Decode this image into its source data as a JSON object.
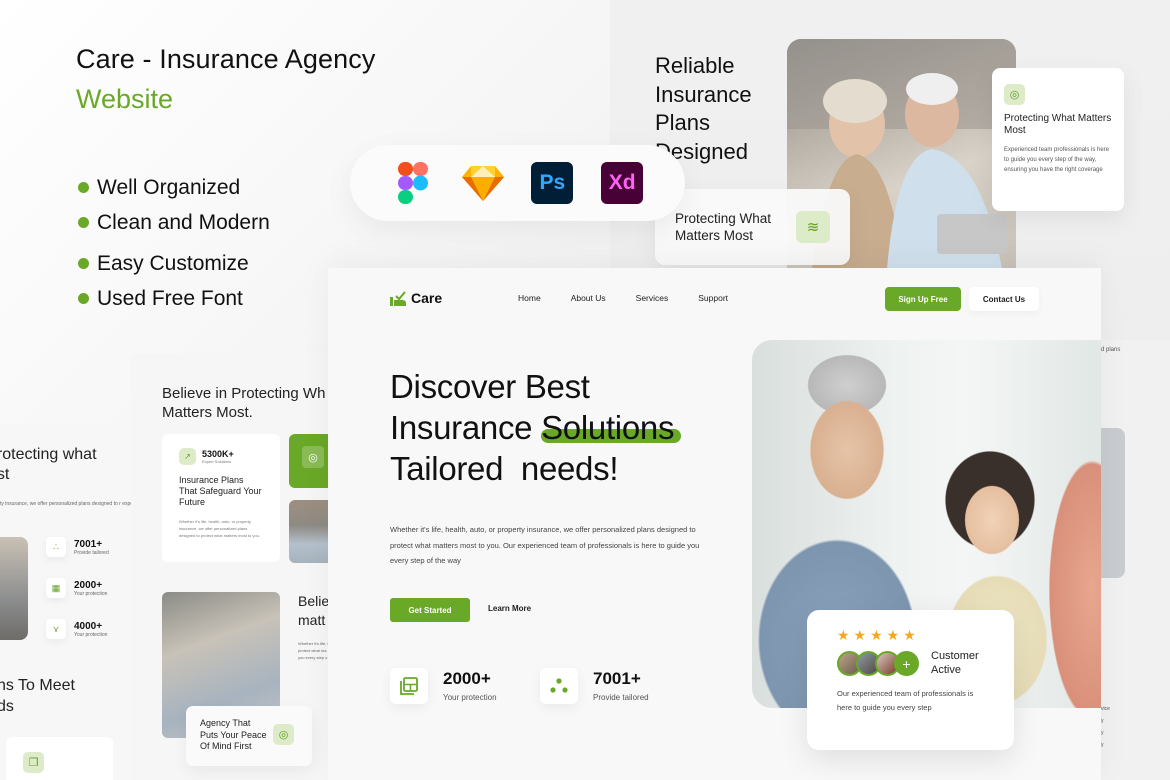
{
  "promo": {
    "title": "Care - Insurance Agency",
    "subtitle": "Website",
    "accent_color": "#6aa827",
    "features": [
      "Well Organized",
      "Clean and Modern",
      "Easy Customize",
      "Used Free Font"
    ],
    "tools": [
      {
        "name": "Figma",
        "icon": "figma-icon"
      },
      {
        "name": "Sketch",
        "icon": "sketch-icon"
      },
      {
        "name": "Photoshop",
        "icon": "photoshop-icon",
        "label": "Ps"
      },
      {
        "name": "Adobe XD",
        "icon": "xd-icon",
        "label": "Xd"
      }
    ]
  },
  "top_right_preview": {
    "heading": [
      "Reliable",
      "Insurance",
      "Plans",
      "Designed"
    ],
    "side_card": {
      "title": "Protecting What Matters Most",
      "text": "Experienced team professionals is here to guide you every step of the way, ensuring you have the right coverage"
    },
    "pill": {
      "title": "Protecting What Matters Most"
    }
  },
  "left_preview_1": {
    "heading": "protecting what most",
    "text": "ty insurance, we offer personalized plans designed to r experienced team of professionals is here to guide",
    "stats": [
      {
        "value": "7001+",
        "caption": "Provide tailored"
      },
      {
        "value": "2000+",
        "caption": "Your protection"
      },
      {
        "value": "4000+",
        "caption": "Your protection"
      }
    ],
    "heading2": "ns To Meet ds"
  },
  "left_preview_2": {
    "heading": "Believe in Protecting Wh Matters Most.",
    "card": {
      "stat_value": "5300K+",
      "stat_caption": "Expert Solutions",
      "title": "Insurance Plans That Safeguard Your Future",
      "text": "Whether it's life, health, auto, or property insurance, we offer personalized plans designed to protect what matters most to you."
    },
    "heading3": "Belie matt",
    "text3": "Whether it's life, i protect what ma you every step o",
    "pill_title": "Agency That Puts Your Peace Of Mind First"
  },
  "right_strip": {
    "text": "d plans",
    "footer": [
      "vice",
      "y",
      "y",
      "y"
    ]
  },
  "main": {
    "brand": "Care",
    "nav": [
      "Home",
      "About Us",
      "Services",
      "Support"
    ],
    "signup_label": "Sign Up Free",
    "contact_label": "Contact Us",
    "hero": {
      "line1": "Discover Best",
      "line2_a": "Insurance ",
      "line2_b": "Solutions",
      "line3": "Tailored  needs!",
      "paragraph": "Whether it's life, health, auto, or property insurance, we offer personalized plans designed to protect what matters most to you. Our experienced team of professionals is here to guide you every step of the way",
      "get_started": "Get Started",
      "learn_more": "Learn More"
    },
    "stats": [
      {
        "value": "2000+",
        "caption": "Your protection",
        "icon": "layout-icon"
      },
      {
        "value": "7001+",
        "caption": "Provide tailored",
        "icon": "dots-icon"
      }
    ],
    "review": {
      "rating": 5,
      "stars": "★★★★★",
      "label": "Customer Active",
      "plus": "+",
      "text": "Our experienced team of professionals is here to guide you every step"
    }
  }
}
